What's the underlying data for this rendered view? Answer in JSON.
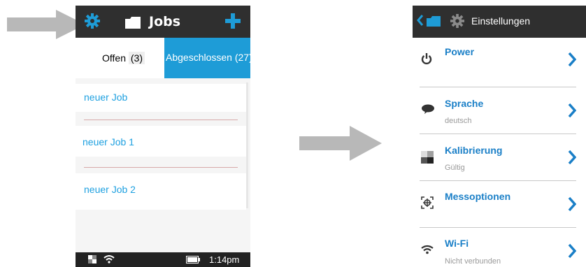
{
  "left": {
    "header": {
      "title": "Jobs"
    },
    "tabs": {
      "open_label": "Offen",
      "open_count": "(3)",
      "done_label": "Abgeschlossen (27)"
    },
    "jobs": [
      "neuer Job",
      "neuer Job 1",
      "neuer Job 2"
    ],
    "status": {
      "time": "1:14pm"
    }
  },
  "right": {
    "header": {
      "title": "Einstellungen"
    },
    "settings": [
      {
        "label": "Power",
        "sub": "",
        "icon": "power-icon"
      },
      {
        "label": "Sprache",
        "sub": "deutsch",
        "icon": "speech-bubble-icon"
      },
      {
        "label": "Kalibrierung",
        "sub": "Gültig",
        "icon": "calibration-icon"
      },
      {
        "label": "Messoptionen",
        "sub": "",
        "icon": "measure-options-icon"
      },
      {
        "label": "Wi-Fi",
        "sub": "Nicht verbunden",
        "icon": "wifi-icon"
      }
    ]
  },
  "colors": {
    "accent": "#1e9cd7",
    "header": "#2f2f2f",
    "arrow": "#b8b8b8"
  }
}
